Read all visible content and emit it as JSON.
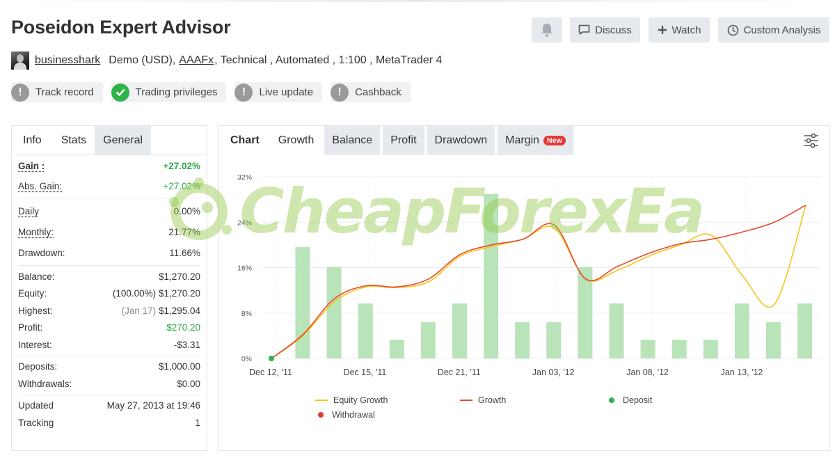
{
  "page": {
    "title": "Poseidon Expert Advisor",
    "buttons": {
      "notify_icon": "bell-icon",
      "discuss": "Discuss",
      "watch": "Watch",
      "custom_analysis": "Custom Analysis"
    },
    "meta": {
      "user": "businesshark",
      "text1": "Demo (USD),",
      "broker": "AAAFx",
      "text2": ", Technical , Automated , 1:100 , MetaTrader 4"
    },
    "badges": [
      {
        "label": "Track record",
        "status": "warning"
      },
      {
        "label": "Trading privileges",
        "status": "ok"
      },
      {
        "label": "Live update",
        "status": "warning"
      },
      {
        "label": "Cashback",
        "status": "warning"
      }
    ]
  },
  "left_panel": {
    "tabs": [
      "Info",
      "Stats",
      "General"
    ],
    "gain_label": "Gain :",
    "gain": "+27.02%",
    "abs_gain_label": "Abs. Gain:",
    "abs_gain": "+27.02%",
    "daily_label": "Daily",
    "daily": "0.00%",
    "monthly_label": "Monthly:",
    "monthly": "21.77%",
    "drawdown_label": "Drawdown:",
    "drawdown": "11.66%",
    "balance_label": "Balance:",
    "balance": "$1,270.20",
    "equity_label": "Equity:",
    "equity": "(100.00%) $1,270.20",
    "highest_label": "Highest:",
    "highest_date": "(Jan 17)",
    "highest": "$1,295.04",
    "profit_label": "Profit:",
    "profit": "$270.20",
    "interest_label": "Interest:",
    "interest": "-$3.31",
    "deposits_label": "Deposits:",
    "deposits": "$1,000.00",
    "withdrawals_label": "Withdrawals:",
    "withdrawals": "$0.00",
    "updated_label": "Updated",
    "updated": "May 27, 2013 at 19:46",
    "tracking_label": "Tracking",
    "tracking": "1"
  },
  "chart_panel": {
    "tabs": [
      "Chart",
      "Growth",
      "Balance",
      "Profit",
      "Drawdown",
      "Margin"
    ],
    "new_badge": "New",
    "watermark": "CheapForexEa",
    "colors": {
      "equity": "#f5c518",
      "growth": "#e8492c",
      "deposit": "#2db34a",
      "withdrawal": "#e53935",
      "bars": "#b9e3b9"
    }
  },
  "chart_data": {
    "type": "line",
    "ylim": [
      0,
      32
    ],
    "yticks": [
      "0%",
      "8%",
      "16%",
      "24%",
      "32%"
    ],
    "xticks": [
      "Dec 12, '11",
      "Dec 15, '11",
      "Dec 21, '11",
      "Jan 03, '12",
      "Jan 08, '12",
      "Jan 13, '12"
    ],
    "legend": [
      "Equity Growth",
      "Growth",
      "Deposit",
      "Withdrawal"
    ],
    "bar_values": [
      19.6,
      16.1,
      9.7,
      3.3,
      6.4,
      9.7,
      29.0,
      6.4,
      6.4,
      16.1,
      9.7,
      3.3,
      3.3,
      3.3,
      9.7,
      6.4,
      9.7
    ],
    "growth": [
      0,
      4.2,
      10.5,
      12.8,
      12.6,
      14.0,
      18.3,
      20.0,
      21.0,
      23.5,
      14.0,
      16.2,
      18.5,
      20.2,
      21.0,
      22.3,
      24.0,
      27.0
    ],
    "equity_growth": [
      0,
      4.0,
      10.0,
      12.6,
      12.5,
      13.5,
      18.0,
      19.7,
      21.0,
      23.0,
      14.0,
      15.5,
      18.0,
      20.0,
      21.7,
      14.5,
      9.5,
      27.0
    ],
    "deposit": [
      0
    ]
  }
}
